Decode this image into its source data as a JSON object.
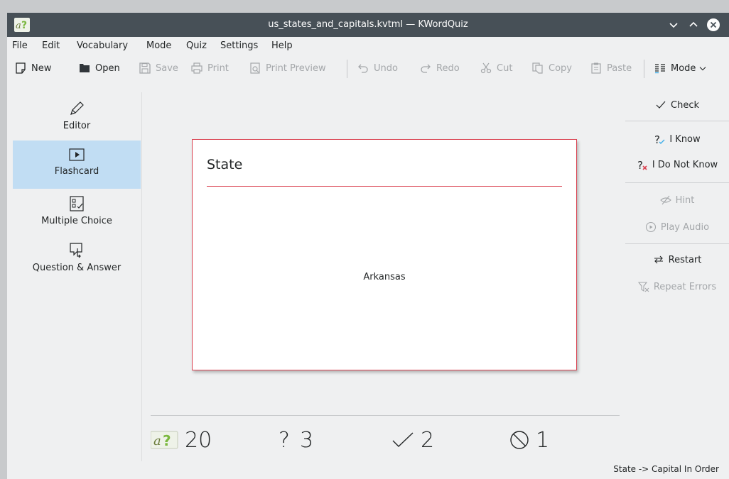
{
  "window": {
    "title": "us_states_and_capitals.kvtml — KWordQuiz",
    "minimize_icon": "chevron-down-icon",
    "maximize_icon": "chevron-up-icon",
    "close_icon": "close-icon"
  },
  "menu": [
    "File",
    "Edit",
    "Vocabulary",
    "Mode",
    "Quiz",
    "Settings",
    "Help"
  ],
  "toolbar": {
    "new": "New",
    "open": "Open",
    "save": "Save",
    "print": "Print",
    "print_preview": "Print Preview",
    "undo": "Undo",
    "redo": "Redo",
    "cut": "Cut",
    "copy": "Copy",
    "paste": "Paste",
    "mode": "Mode"
  },
  "modes": [
    {
      "label": "Editor",
      "icon": "pencil-icon",
      "active": false
    },
    {
      "label": "Flashcard",
      "icon": "play-icon",
      "active": true
    },
    {
      "label": "Multiple Choice",
      "icon": "checklist-icon",
      "active": false
    },
    {
      "label": "Question & Answer",
      "icon": "question-answer-icon",
      "active": false
    }
  ],
  "card": {
    "heading": "State",
    "word": "Arkansas"
  },
  "score": {
    "total": "20",
    "questions": "3",
    "correct": "2",
    "errors": "1"
  },
  "actions": {
    "check": "Check",
    "i_know": "I Know",
    "i_do_not_know": "I Do Not Know",
    "hint": "Hint",
    "play_audio": "Play Audio",
    "restart": "Restart",
    "repeat_errors": "Repeat Errors"
  },
  "status": {
    "mode_text": "State -> Capital In Order"
  },
  "colors": {
    "accent": "#da4453",
    "selection": "#c1ddf3",
    "titlebar": "#475057"
  }
}
